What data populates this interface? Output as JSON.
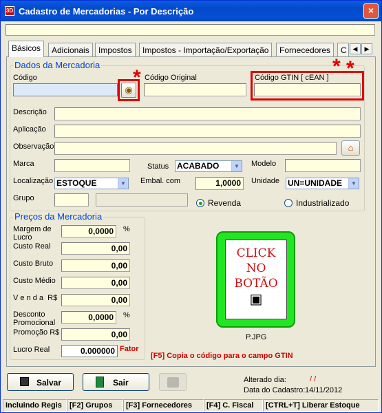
{
  "window": {
    "title": "Cadastro de Mercadorias - Por Descrição",
    "close": "×",
    "app_icon": "3D"
  },
  "tabs": [
    "Básicos",
    "Adicionais",
    "Impostos",
    "Impostos - Importação/Exportação",
    "Fornecedores",
    "C"
  ],
  "tab_scroll": {
    "left": "◀",
    "right": "▶"
  },
  "dados": {
    "group_title": "Dados da Mercadoria",
    "codigo_label": "Código",
    "codigo_value": "",
    "codigo_original_label": "Código Original",
    "gtin_label": "Código GTIN [ cEAN ]",
    "descricao_label": "Descrição",
    "aplicacao_label": "Aplicação",
    "observacao_label": "Observação",
    "marca_label": "Marca",
    "status_label": "Status",
    "status_value": "ACABADO",
    "modelo_label": "Modelo",
    "localizacao_label": "Localização",
    "localizacao_value": "ESTOQUE",
    "embal_label": "Embal. com",
    "embal_value": "1,0000",
    "unidade_label": "Unidade",
    "unidade_value": "UN=UNIDADE",
    "grupo_label": "Grupo",
    "revenda_label": "Revenda",
    "industrializado_label": "Industrializado"
  },
  "precos": {
    "group_title": "Preços da Mercadoria",
    "margem_label": "Margem de Lucro",
    "margem_value": "0,0000",
    "margem_unit": "%",
    "custo_real_label": "Custo Real",
    "custo_real_value": "0,00",
    "custo_bruto_label": "Custo Bruto",
    "custo_bruto_value": "0,00",
    "custo_medio_label": "Custo Médio",
    "custo_medio_value": "0,00",
    "venda_label": "V e n d a  R$",
    "venda_value": "0,00",
    "desconto_label": "Desconto Promocional",
    "desconto_value": "0,0000",
    "desconto_unit": "%",
    "promocao_label": "Promoção R$",
    "promocao_value": "0,00",
    "lucro_label": "Lucro Real",
    "lucro_value": "0.000000",
    "fator_label": "Fator"
  },
  "photo": {
    "lines": [
      "CLICK",
      "NO",
      "BOTÃO"
    ],
    "filename": "P.JPG"
  },
  "hint": "[F5] Copia o código para o campo GTIN",
  "buttons": {
    "salvar": "Salvar",
    "sair": "Sair"
  },
  "alterado_label": "Alterado dia:",
  "alterado_value": "/ /",
  "cadastro_label": "Data do Cadastro:",
  "cadastro_value": "14/11/2012",
  "statusbar": [
    "Incluindo Regis",
    "[F2] Grupos",
    "[F3] Fornecedores",
    "[F4] C. Fiscal",
    "[CTRL+T] Liberar Estoque"
  ],
  "colors": {
    "title_blue": "#0550d8",
    "field_yellow": "#ffffe0",
    "group_title": "#0046d5",
    "highlight_red": "#e00000",
    "photo_green": "#22e622"
  }
}
